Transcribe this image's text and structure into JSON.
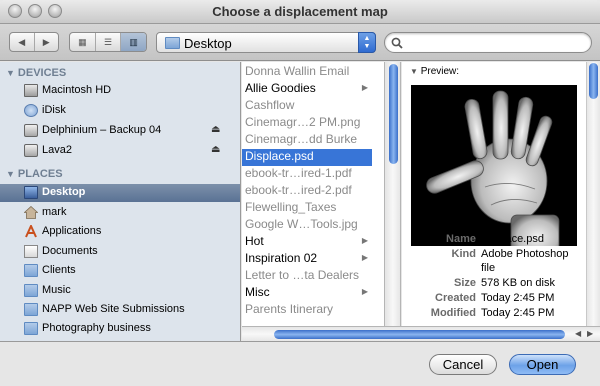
{
  "window": {
    "title": "Choose a displacement map"
  },
  "toolbar": {
    "back_icon": "back-arrow-icon",
    "forward_icon": "forward-arrow-icon",
    "view_icon_icon": "icon-view-icon",
    "view_list_icon": "list-view-icon",
    "view_column_icon": "column-view-icon",
    "location": "Desktop",
    "search_placeholder": ""
  },
  "sidebar": {
    "devices_label": "DEVICES",
    "places_label": "PLACES",
    "devices": [
      {
        "label": "Macintosh HD",
        "icon": "hard-drive-icon",
        "eject": false
      },
      {
        "label": "iDisk",
        "icon": "idisk-icon",
        "eject": false
      },
      {
        "label": "Delphinium – Backup 04",
        "icon": "external-drive-icon",
        "eject": true
      },
      {
        "label": "Lava2",
        "icon": "external-drive-icon",
        "eject": true
      }
    ],
    "places": [
      {
        "label": "Desktop",
        "icon": "desktop-icon",
        "selected": true
      },
      {
        "label": "mark",
        "icon": "home-icon"
      },
      {
        "label": "Applications",
        "icon": "applications-icon"
      },
      {
        "label": "Documents",
        "icon": "folder-icon"
      },
      {
        "label": "Clients",
        "icon": "folder-icon"
      },
      {
        "label": "Music",
        "icon": "folder-icon"
      },
      {
        "label": "NAPP Web Site Submissions",
        "icon": "folder-icon"
      },
      {
        "label": "Photography business",
        "icon": "folder-icon"
      }
    ]
  },
  "files": [
    {
      "name": "Donna Wallin Email",
      "dim": true,
      "folder": false
    },
    {
      "name": "Allie Goodies",
      "dim": false,
      "folder": true
    },
    {
      "name": "Cashflow",
      "dim": true,
      "folder": false
    },
    {
      "name": "Cinemagr…2 PM.png",
      "dim": true,
      "folder": false
    },
    {
      "name": "Cinemagr…dd Burke",
      "dim": true,
      "folder": false
    },
    {
      "name": "Displace.psd",
      "dim": false,
      "folder": false,
      "selected": true
    },
    {
      "name": "ebook-tr…ired-1.pdf",
      "dim": true,
      "folder": false
    },
    {
      "name": "ebook-tr…ired-2.pdf",
      "dim": true,
      "folder": false
    },
    {
      "name": "Flewelling_Taxes",
      "dim": true,
      "folder": false
    },
    {
      "name": "Google W…Tools.jpg",
      "dim": true,
      "folder": false
    },
    {
      "name": "Hot",
      "dim": false,
      "folder": true
    },
    {
      "name": "Inspiration 02",
      "dim": false,
      "folder": true
    },
    {
      "name": "Letter to …ta Dealers",
      "dim": true,
      "folder": false
    },
    {
      "name": "Misc",
      "dim": false,
      "folder": true
    },
    {
      "name": "Parents Itinerary",
      "dim": true,
      "folder": false
    }
  ],
  "preview": {
    "title": "Preview:",
    "image_icon": "hand-photo-image",
    "fields": [
      {
        "key": "Name",
        "value": "Displace.psd"
      },
      {
        "key": "Kind",
        "value": "Adobe Photoshop"
      },
      {
        "key": "",
        "value": "file"
      },
      {
        "key": "Size",
        "value": "578 KB on disk"
      },
      {
        "key": "Created",
        "value": "Today 2:45 PM"
      },
      {
        "key": "Modified",
        "value": "Today 2:45 PM"
      }
    ]
  },
  "buttons": {
    "cancel": "Cancel",
    "open": "Open"
  }
}
